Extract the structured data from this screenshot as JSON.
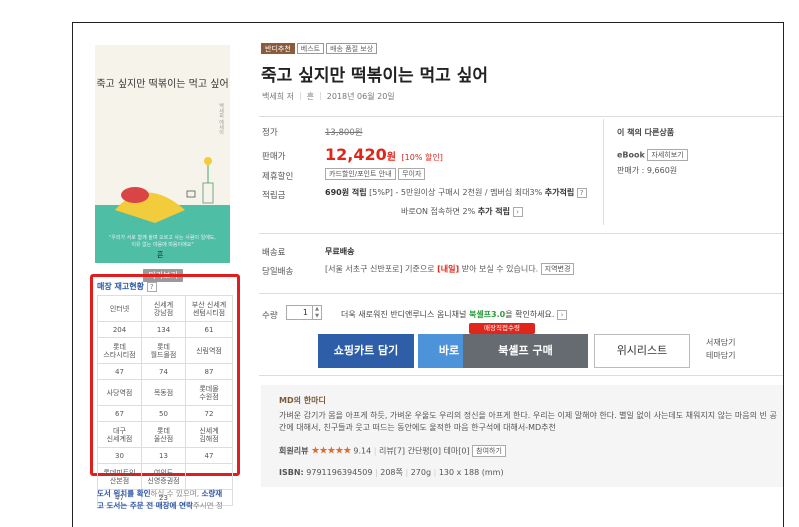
{
  "book": {
    "badges": [
      "반디추천",
      "베스트",
      "배송 품절 보상"
    ],
    "title": "죽고 싶지만 떡볶이는 먹고 싶어",
    "author": "백세희 저",
    "publisher": "흔",
    "date": "2018년 06월 20일",
    "cover_title": "죽고 싶지만 떡볶이는 먹고 싶어",
    "cover_side": "백세희 에세이",
    "cover_blurb_1": "\"우리가 서로 함께 울며 오르고 사는 사람이 일에도,",
    "cover_blurb_2": "이유 없는 마음에 마음이에요\"",
    "cover_logo": "흔",
    "preview_label": "미리보기"
  },
  "stock": {
    "title": "매장 재고현황",
    "help": "?",
    "stores": [
      [
        "인터넷",
        "신세계\n강남점",
        "부산 신세계\n센텀시티점"
      ],
      [
        "204",
        "134",
        "61"
      ],
      [
        "롯데\n스타시티점",
        "롯데\n월드몰점",
        "신림역점"
      ],
      [
        "47",
        "74",
        "87"
      ],
      [
        "사당역점",
        "목동점",
        "롯데몰\n수원점"
      ],
      [
        "67",
        "50",
        "72"
      ],
      [
        "대구\n신세계점",
        "롯데\n울산점",
        "신세계\n김해점"
      ],
      [
        "30",
        "13",
        "47"
      ],
      [
        "롯데피트인\n산본점",
        "여의도\n신영증권점",
        ""
      ],
      [
        "47",
        "23",
        ""
      ]
    ],
    "note_1": "도서 위치를 확인",
    "note_2": "하실 수 있으며, ",
    "note_3": "소량재",
    "note_4": "고 도서는 주문 전 매장에 연락",
    "note_5": "주시면 정"
  },
  "price": {
    "list_label": "정가",
    "list_value": "13,800원",
    "sale_label": "판매가",
    "sale_value": "12,420",
    "won": "원",
    "discount": "[10% 할인]",
    "partner_label": "제휴할인",
    "partner_btns": [
      "카드할인/포인트 안내",
      "무이자"
    ],
    "points_label": "적립금",
    "points_value": "690원 적립",
    "points_pct": "[5%P]",
    "points_desc_1": "- 5만원이상 구매시 2천원 / 멤버십 최대3%",
    "points_desc_2": "추가적립",
    "bandi_on_1": "바로ON 접속하면 2%",
    "bandi_on_2": "추가 적립",
    "shipping_label": "배송료",
    "shipping_value": "무료배송",
    "sameday_label": "당일배송",
    "sameday_1": "[서울 서초구 신반포로] 기준으로",
    "sameday_2": "[내일]",
    "sameday_3": "받아 보실 수 있습니다.",
    "region_change": "지역변경"
  },
  "ebook": {
    "title": "이 책의 다른상품",
    "label": "eBook",
    "detail_btn": "자세히보기",
    "price_label": "판매가 :",
    "price_value": "9,660원"
  },
  "actions": {
    "qty_label": "수량",
    "qty_value": "1",
    "note_1": "더욱 새로워진 반디앤루니스 옴니채널",
    "note_2": "북셸프3.0",
    "note_3": "을 확인하세요.",
    "tag": "매장직접수령",
    "cart": "쇼핑카트 담기",
    "buy": "바로 구매",
    "shelf": "북셸프 구매",
    "wish": "위시리스트",
    "side_1": "서재담기",
    "side_2": "테마담기"
  },
  "md": {
    "title": "MD의 한마디",
    "text": "가벼운 감기가 몸을 아프게 하듯, 가벼운 우울도 우리의 정신을 아프게 한다. 우리는 이제 말해야 한다. 별일 없이 사는데도 채워지지 않는 마음의 빈 공간에 대해서, 친구들과 웃고 떠드는 동안에도 울적한 마음 한구석에 대해서-MD추천",
    "rating_label": "회원리뷰",
    "stars": "★★★★★",
    "score": "9.14",
    "review": "리뷰[7]  간단평[0]  테마[0]",
    "write_btn": "참여하기",
    "isbn_label": "ISBN:",
    "isbn": "9791196394509",
    "pages": "208쪽",
    "weight": "270g",
    "size": "130 x 188 (mm)"
  },
  "colors": {
    "accent_red": "#e0261b",
    "cart_blue": "#2e5ea8",
    "buy_blue": "#4d93d9",
    "shelf_gray": "#656b71",
    "cover_teal": "#4ebfa4"
  }
}
